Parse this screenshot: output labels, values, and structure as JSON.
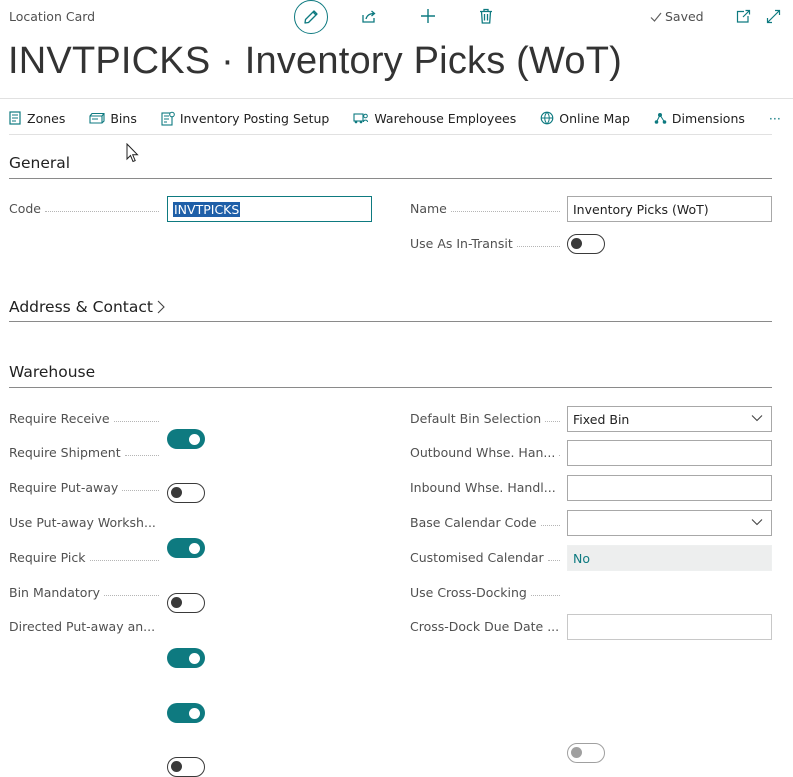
{
  "header": {
    "card_type": "Location Card",
    "status": "Saved",
    "title": "INVTPICKS · Inventory Picks (WoT)",
    "icons": [
      "edit-icon",
      "share-icon",
      "plus-icon",
      "delete-icon",
      "check-icon",
      "open-new-window-icon",
      "expand-icon"
    ]
  },
  "actions": [
    {
      "label": "Zones",
      "icon": "zones-icon"
    },
    {
      "label": "Bins",
      "icon": "bins-icon"
    },
    {
      "label": "Inventory Posting Setup",
      "icon": "posting-setup-icon"
    },
    {
      "label": "Warehouse Employees",
      "icon": "warehouse-employees-icon"
    },
    {
      "label": "Online Map",
      "icon": "online-map-icon"
    },
    {
      "label": "Dimensions",
      "icon": "dimensions-icon"
    },
    {
      "label": "···",
      "icon": "more-icon"
    }
  ],
  "general": {
    "title": "General",
    "code_label": "Code",
    "code_value": "INVTPICKS",
    "name_label": "Name",
    "name_value": "Inventory Picks (WoT)",
    "in_transit_label": "Use As In-Transit",
    "in_transit": false
  },
  "address": {
    "title": "Address & Contact"
  },
  "warehouse": {
    "title": "Warehouse",
    "left": [
      {
        "label": "Require Receive",
        "value": true
      },
      {
        "label": "Require Shipment",
        "value": false
      },
      {
        "label": "Require Put-away",
        "value": true
      },
      {
        "label": "Use Put-away Worksh...",
        "value": false
      },
      {
        "label": "Require Pick",
        "value": true
      },
      {
        "label": "Bin Mandatory",
        "value": true
      },
      {
        "label": "Directed Put-away an...",
        "value": false
      }
    ],
    "right": {
      "default_bin_label": "Default Bin Selection",
      "default_bin_value": "Fixed Bin",
      "outbound_label": "Outbound Whse. Han...",
      "outbound_value": "",
      "inbound_label": "Inbound Whse. Handl...",
      "inbound_value": "",
      "base_cal_label": "Base Calendar Code",
      "base_cal_value": "",
      "custom_cal_label": "Customised Calendar",
      "custom_cal_value": "No",
      "cross_dock_label": "Use Cross-Docking",
      "cross_dock": false,
      "cross_dock_due_label": "Cross-Dock Due Date ...",
      "cross_dock_due_value": ""
    }
  },
  "colors": {
    "accent": "#0e7a80",
    "selection": "#1e5fa8"
  }
}
